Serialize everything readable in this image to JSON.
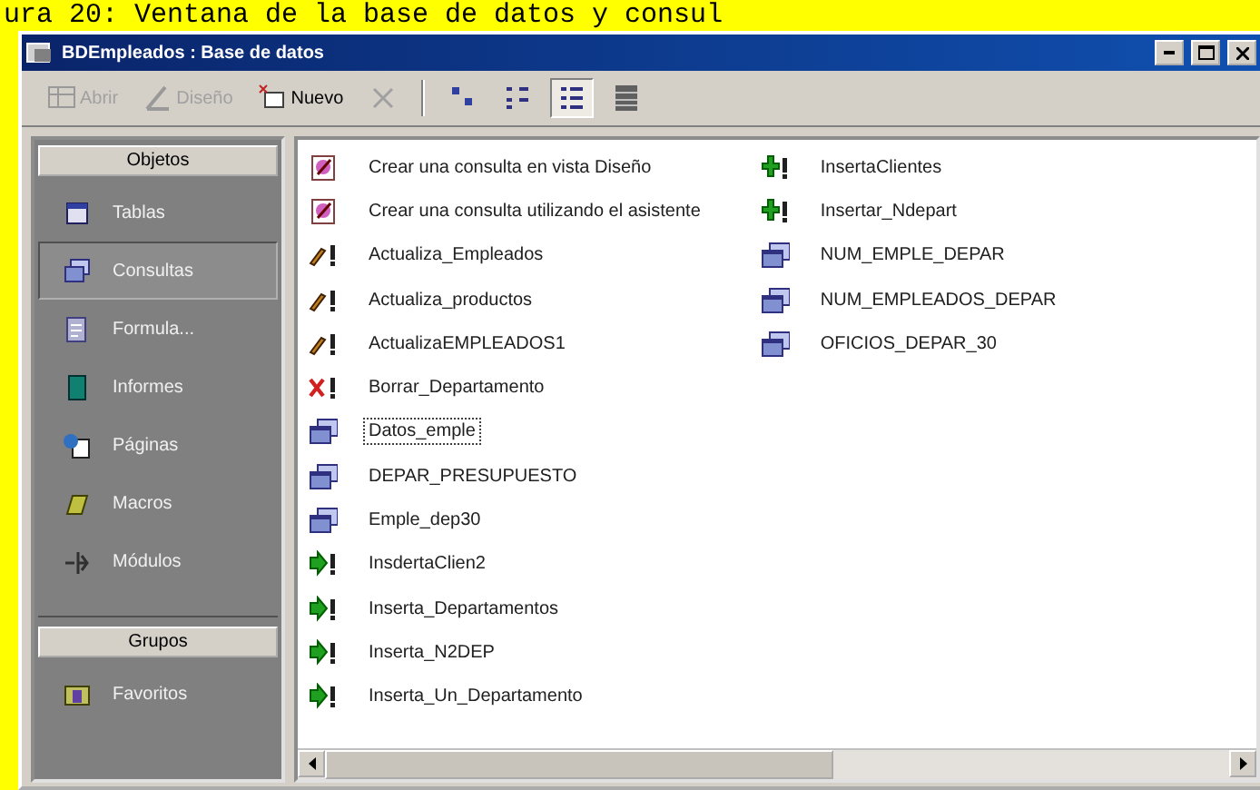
{
  "caption": "ura 20: Ventana de la base de datos y consul",
  "window": {
    "title": "BDEmpleados : Base de datos"
  },
  "toolbar": [
    {
      "kind": "open",
      "label": "Abrir",
      "disabled": true
    },
    {
      "kind": "design",
      "label": "Diseño",
      "disabled": true
    },
    {
      "kind": "new",
      "label": "Nuevo",
      "disabled": false
    },
    {
      "kind": "delete",
      "disabled": true
    },
    {
      "kind": "large",
      "selected": false
    },
    {
      "kind": "small",
      "selected": false
    },
    {
      "kind": "list",
      "selected": true
    },
    {
      "kind": "details",
      "selected": false
    }
  ],
  "sidebar": {
    "sections": [
      {
        "title": "Objetos",
        "items": [
          {
            "label": "Tablas",
            "kind": "table",
            "selected": false
          },
          {
            "label": "Consultas",
            "kind": "query",
            "selected": true
          },
          {
            "label": "Formula...",
            "kind": "form",
            "selected": false
          },
          {
            "label": "Informes",
            "kind": "report",
            "selected": false
          },
          {
            "label": "Páginas",
            "kind": "page",
            "selected": false
          },
          {
            "label": "Macros",
            "kind": "macro",
            "selected": false
          },
          {
            "label": "Módulos",
            "kind": "module",
            "selected": false
          }
        ]
      },
      {
        "title": "Grupos",
        "items": [
          {
            "label": "Favoritos",
            "kind": "favorites",
            "selected": false
          }
        ]
      }
    ]
  },
  "list": {
    "items": [
      {
        "label": "Crear una consulta en vista Diseño",
        "kind": "wizard",
        "selected": false
      },
      {
        "label": "Crear una consulta utilizando el asistente",
        "kind": "wizard",
        "selected": false
      },
      {
        "label": "Actualiza_Empleados",
        "kind": "update",
        "selected": false
      },
      {
        "label": "Actualiza_productos",
        "kind": "update",
        "selected": false
      },
      {
        "label": "ActualizaEMPLEADOS1",
        "kind": "update",
        "selected": false
      },
      {
        "label": "Borrar_Departamento",
        "kind": "delete",
        "selected": false
      },
      {
        "label": "Datos_emple",
        "kind": "select",
        "selected": true
      },
      {
        "label": "DEPAR_PRESUPUESTO",
        "kind": "select",
        "selected": false
      },
      {
        "label": "Emple_dep30",
        "kind": "select",
        "selected": false
      },
      {
        "label": "InsdertaClien2",
        "kind": "append",
        "selected": false
      },
      {
        "label": "Inserta_Departamentos",
        "kind": "append",
        "selected": false
      },
      {
        "label": "Inserta_N2DEP",
        "kind": "append",
        "selected": false
      },
      {
        "label": "Inserta_Un_Departamento",
        "kind": "append",
        "selected": false
      },
      {
        "label": "InsertaClientes",
        "kind": "insert",
        "selected": false
      },
      {
        "label": "Insertar_Ndepart",
        "kind": "insert",
        "selected": false
      },
      {
        "label": "NUM_EMPLE_DEPAR",
        "kind": "select",
        "selected": false
      },
      {
        "label": "NUM_EMPLEADOS_DEPAR",
        "kind": "select",
        "selected": false
      },
      {
        "label": "OFICIOS_DEPAR_30",
        "kind": "select",
        "selected": false
      }
    ]
  }
}
